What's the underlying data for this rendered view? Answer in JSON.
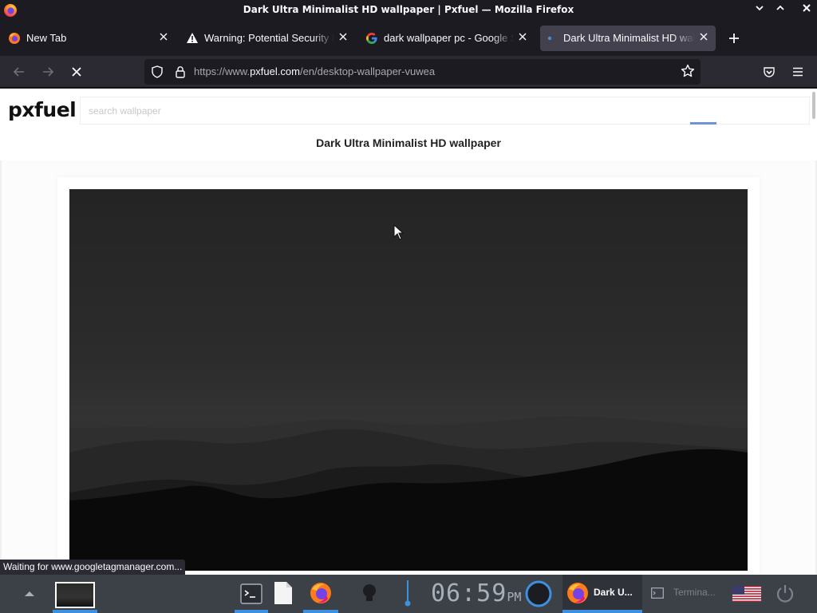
{
  "window": {
    "title": "Dark Ultra Minimalist HD wallpaper | Pxfuel — Mozilla Firefox",
    "minimize_icon": "chevron-down-icon",
    "maximize_icon": "chevron-up-icon",
    "close_icon": "close-icon"
  },
  "tabs": [
    {
      "label": "New Tab",
      "icon": "firefox-icon",
      "active": false
    },
    {
      "label": "Warning: Potential Security Risk Ahead",
      "icon": "warning-icon",
      "active": false
    },
    {
      "label": "dark wallpaper pc - Google Search",
      "icon": "google-icon",
      "active": false
    },
    {
      "label": "Dark Ultra Minimalist HD wallpaper",
      "icon": "loading-dot-icon",
      "active": true
    }
  ],
  "toolbar": {
    "url_prefix": "https://www.",
    "url_domain": "pxfuel.com",
    "url_path": "/en/desktop-wallpaper-vuwea",
    "back_icon": "arrow-left-icon",
    "forward_icon": "arrow-right-icon",
    "stop_icon": "stop-icon"
  },
  "page": {
    "logo": "pxfuel",
    "search_placeholder": "search wallpaper",
    "title": "Dark Ultra Minimalist HD wallpaper"
  },
  "status_text": "Waiting for www.googletagmanager.com...",
  "taskbar": {
    "clock_time": "06:59",
    "clock_ampm": "PM",
    "firefox_window_label": "Dark U...",
    "terminal_window_label": "Termina...",
    "keyboard_layout": "us-flag-icon"
  },
  "colors": {
    "accent": "#3d8fe0",
    "tab_active": "#42414d",
    "toolbar_bg": "#2b2a33",
    "chrome_bg": "#1c1b22",
    "taskbar_bg": "#3c4047"
  }
}
